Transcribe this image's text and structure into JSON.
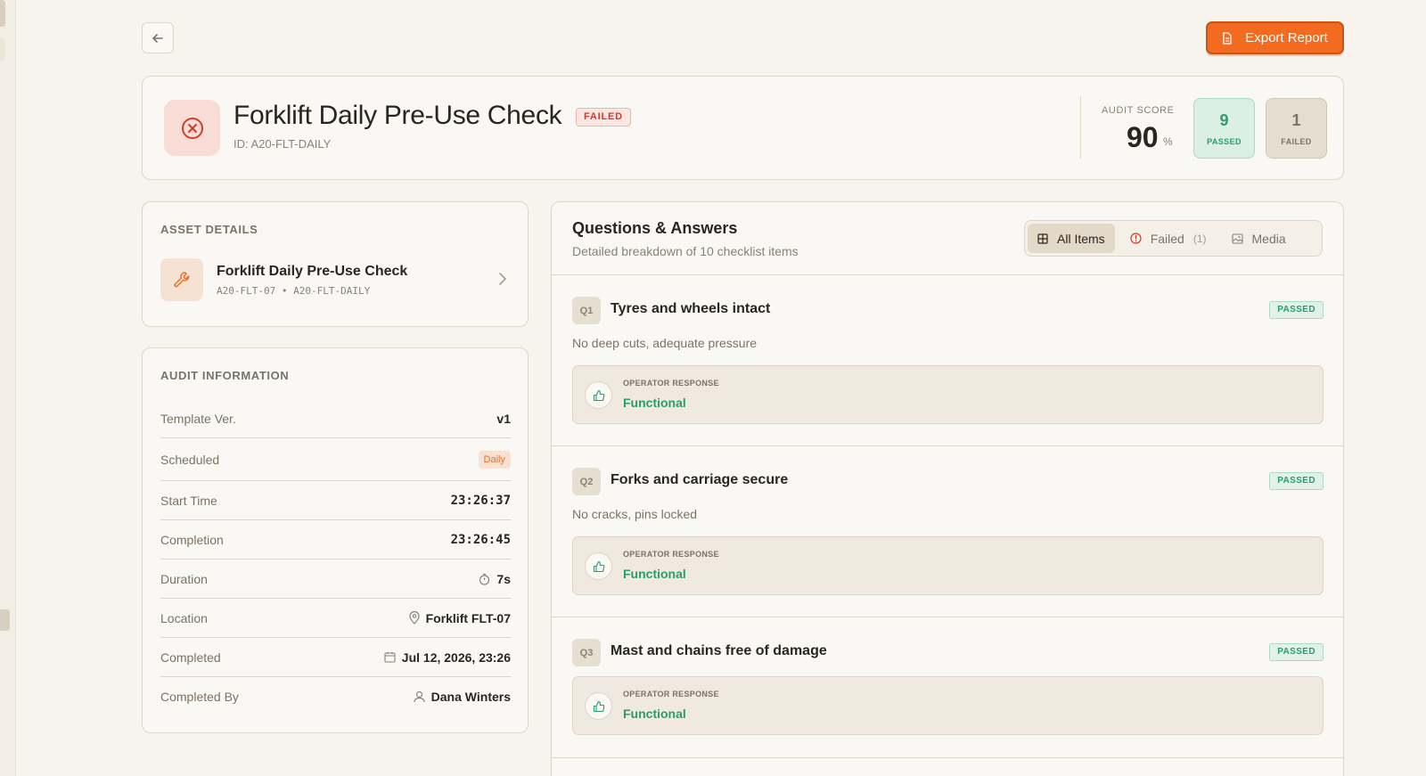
{
  "header": {
    "export_label": "Export Report",
    "title": "Forklift Daily Pre-Use Check",
    "status": "FAILED",
    "id_text": "ID: A20-FLT-DAILY",
    "audit_score_label": "AUDIT SCORE",
    "audit_score": "90",
    "audit_score_unit": "%",
    "passed_count": "9",
    "passed_label": "PASSED",
    "failed_count": "1",
    "failed_label": "FAILED"
  },
  "asset": {
    "section_label": "ASSET DETAILS",
    "name": "Forklift Daily Pre-Use Check",
    "codes": "A20-FLT-07 • A20-FLT-DAILY"
  },
  "audit_info": {
    "section_label": "AUDIT INFORMATION",
    "rows": [
      {
        "key": "Template Ver.",
        "value": "v1"
      },
      {
        "key": "Scheduled",
        "value": "Daily"
      },
      {
        "key": "Start Time",
        "value": "23:26:37"
      },
      {
        "key": "Completion",
        "value": "23:26:45"
      },
      {
        "key": "Duration",
        "value": "7s"
      },
      {
        "key": "Location",
        "value": "Forklift FLT-07"
      },
      {
        "key": "Completed",
        "value": "Jul 12, 2026, 23:26"
      },
      {
        "key": "Completed By",
        "value": "Dana Winters"
      }
    ]
  },
  "qa": {
    "title": "Questions & Answers",
    "subtitle": "Detailed breakdown of 10 checklist items",
    "tabs": [
      {
        "label": "All Items",
        "count": ""
      },
      {
        "label": "Failed",
        "count": "(1)"
      },
      {
        "label": "Media",
        "count": ""
      }
    ],
    "questions": [
      {
        "num": "Q1",
        "title": "Tyres and wheels intact",
        "status": "PASSED",
        "desc": "No deep cuts, adequate pressure",
        "response_label": "OPERATOR RESPONSE",
        "response": "Functional"
      },
      {
        "num": "Q2",
        "title": "Forks and carriage secure",
        "status": "PASSED",
        "desc": "No cracks, pins locked",
        "response_label": "OPERATOR RESPONSE",
        "response": "Functional"
      },
      {
        "num": "Q3",
        "title": "Mast and chains free of damage",
        "status": "PASSED",
        "desc": "",
        "response_label": "OPERATOR RESPONSE",
        "response": "Functional"
      }
    ]
  },
  "colors": {
    "accent": "#f26b21",
    "fail": "#d23b2a",
    "pass": "#2a9d6a",
    "background": "#f7f4ee"
  }
}
